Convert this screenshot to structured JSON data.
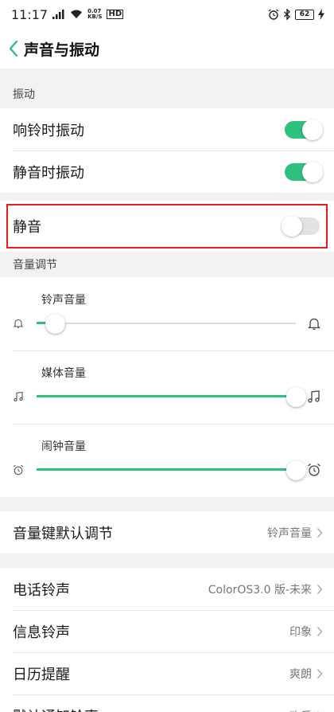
{
  "status": {
    "time": "11:17",
    "speed_value": "0.07",
    "speed_unit": "KB/S",
    "hd": "HD",
    "battery": "62"
  },
  "header": {
    "title": "声音与振动"
  },
  "vibration": {
    "section": "振动",
    "items": [
      {
        "label": "响铃时振动",
        "on": true
      },
      {
        "label": "静音时振动",
        "on": true
      }
    ]
  },
  "mute": {
    "label": "静音",
    "on": false
  },
  "volume": {
    "section": "音量调节",
    "sliders": [
      {
        "label": "铃声音量",
        "value": 0.07
      },
      {
        "label": "媒体音量",
        "value": 1.0
      },
      {
        "label": "闹钟音量",
        "value": 1.0
      }
    ]
  },
  "volume_key": {
    "label": "音量键默认调节",
    "value": "铃声音量"
  },
  "ringtones": [
    {
      "label": "电话铃声",
      "value": "ColorOS3.0 版-未来"
    },
    {
      "label": "信息铃声",
      "value": "印象"
    },
    {
      "label": "日历提醒",
      "value": "爽朗"
    },
    {
      "label": "默认通知铃声",
      "value": "欢乐"
    }
  ],
  "colors": {
    "accent": "#2ec07f",
    "highlight_border": "#e41d1d"
  }
}
